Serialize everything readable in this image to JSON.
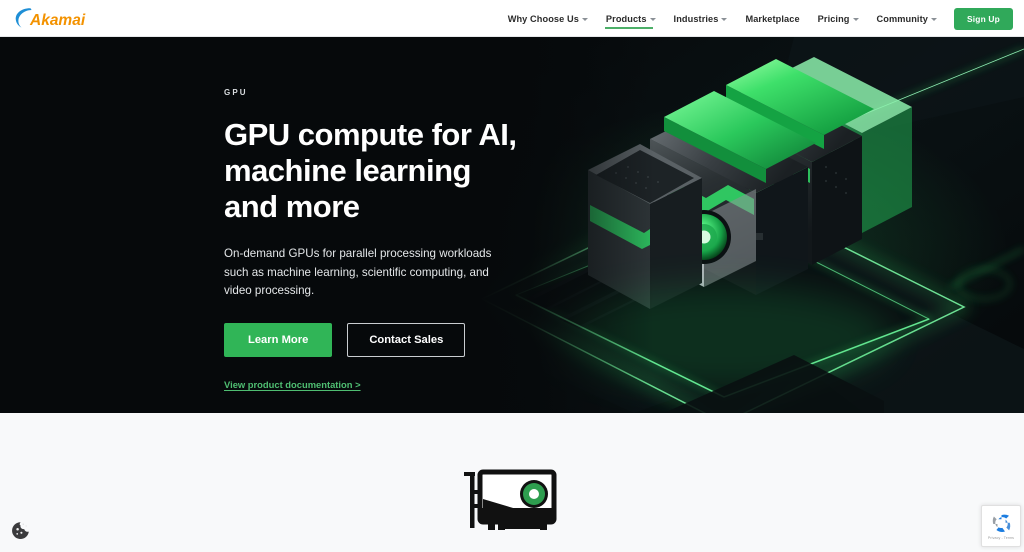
{
  "brand": {
    "logo_text": "Akamai",
    "logo_swoosh_color": "#1f8fd6",
    "logo_text_color": "#f39200",
    "accent_green": "#30b557",
    "nav_active_underline": "#4caf68"
  },
  "header": {
    "nav_items": [
      {
        "label": "Why Choose Us",
        "has_dropdown": true,
        "active": false
      },
      {
        "label": "Products",
        "has_dropdown": true,
        "active": true
      },
      {
        "label": "Industries",
        "has_dropdown": true,
        "active": false
      },
      {
        "label": "Marketplace",
        "has_dropdown": false,
        "active": false
      },
      {
        "label": "Pricing",
        "has_dropdown": true,
        "active": false
      },
      {
        "label": "Community",
        "has_dropdown": true,
        "active": false
      }
    ],
    "signup_label": "Sign Up"
  },
  "hero": {
    "eyebrow": "GPU",
    "title": "GPU compute for AI, machine learning and more",
    "description": "On-demand GPUs for parallel processing workloads such as machine learning, scientific computing, and video processing.",
    "primary_cta": "Learn More",
    "secondary_cta": "Contact Sales",
    "doc_link": "View product documentation >",
    "background_color": "#06090b",
    "illustration": "isometric-gpu-stack-render"
  },
  "lower_section": {
    "background_color": "#f8f9fa",
    "icon": "gpu-card-icon",
    "icon_fan_color": "#2e9e4f"
  },
  "widgets": {
    "cookie_icon": "cookie-icon",
    "recaptcha_icon": "recaptcha-icon",
    "recaptcha_legal": "Privacy - Terms"
  }
}
